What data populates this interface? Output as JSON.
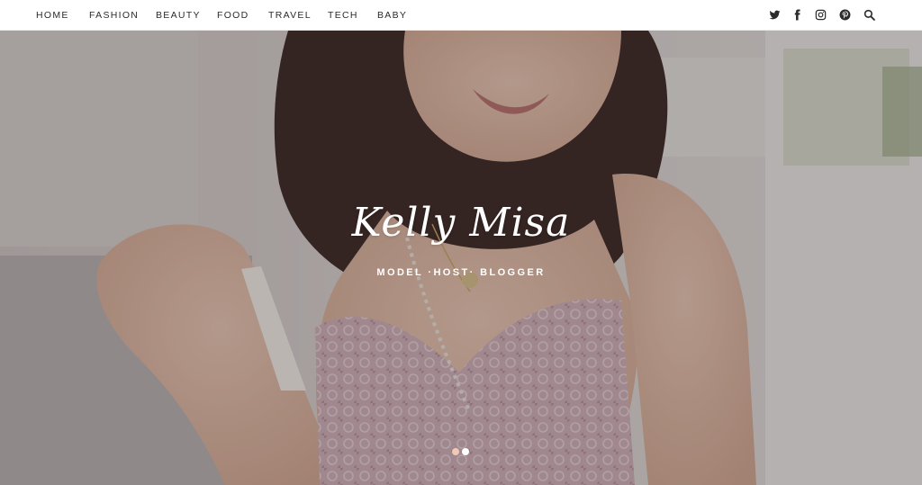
{
  "nav": {
    "items": [
      {
        "label": "HOME"
      },
      {
        "label": "FASHION"
      },
      {
        "label": "BEAUTY"
      },
      {
        "label": "FOOD"
      },
      {
        "label": "TRAVEL"
      },
      {
        "label": "TECH"
      },
      {
        "label": "BABY"
      }
    ]
  },
  "social": {
    "icons": [
      "twitter-icon",
      "facebook-icon",
      "instagram-icon",
      "pinterest-icon",
      "search-icon"
    ]
  },
  "hero": {
    "title": "Kelly Misa",
    "tagline": "MODEL ·HOST· BLOGGER",
    "slides": {
      "count": 2,
      "active": 1
    }
  },
  "colors": {
    "nav_text": "#2b2b2b",
    "dot_active": "#f0c9b7",
    "dot_inactive": "#ffffff",
    "dress": "#c9a8b0",
    "hair": "#3a2622"
  }
}
